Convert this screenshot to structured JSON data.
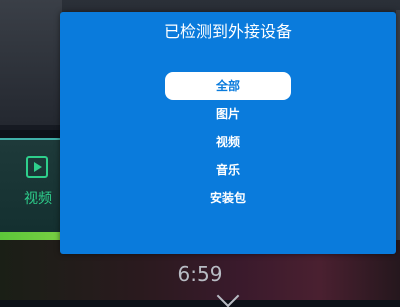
{
  "background": {
    "tile_label": "视频",
    "clock": "6:59"
  },
  "dialog": {
    "title": "已检测到外接设备",
    "items": [
      {
        "label": "全部",
        "selected": true
      },
      {
        "label": "图片",
        "selected": false
      },
      {
        "label": "视频",
        "selected": false
      },
      {
        "label": "音乐",
        "selected": false
      },
      {
        "label": "安装包",
        "selected": false
      }
    ],
    "accent_color": "#0a7bdc"
  }
}
